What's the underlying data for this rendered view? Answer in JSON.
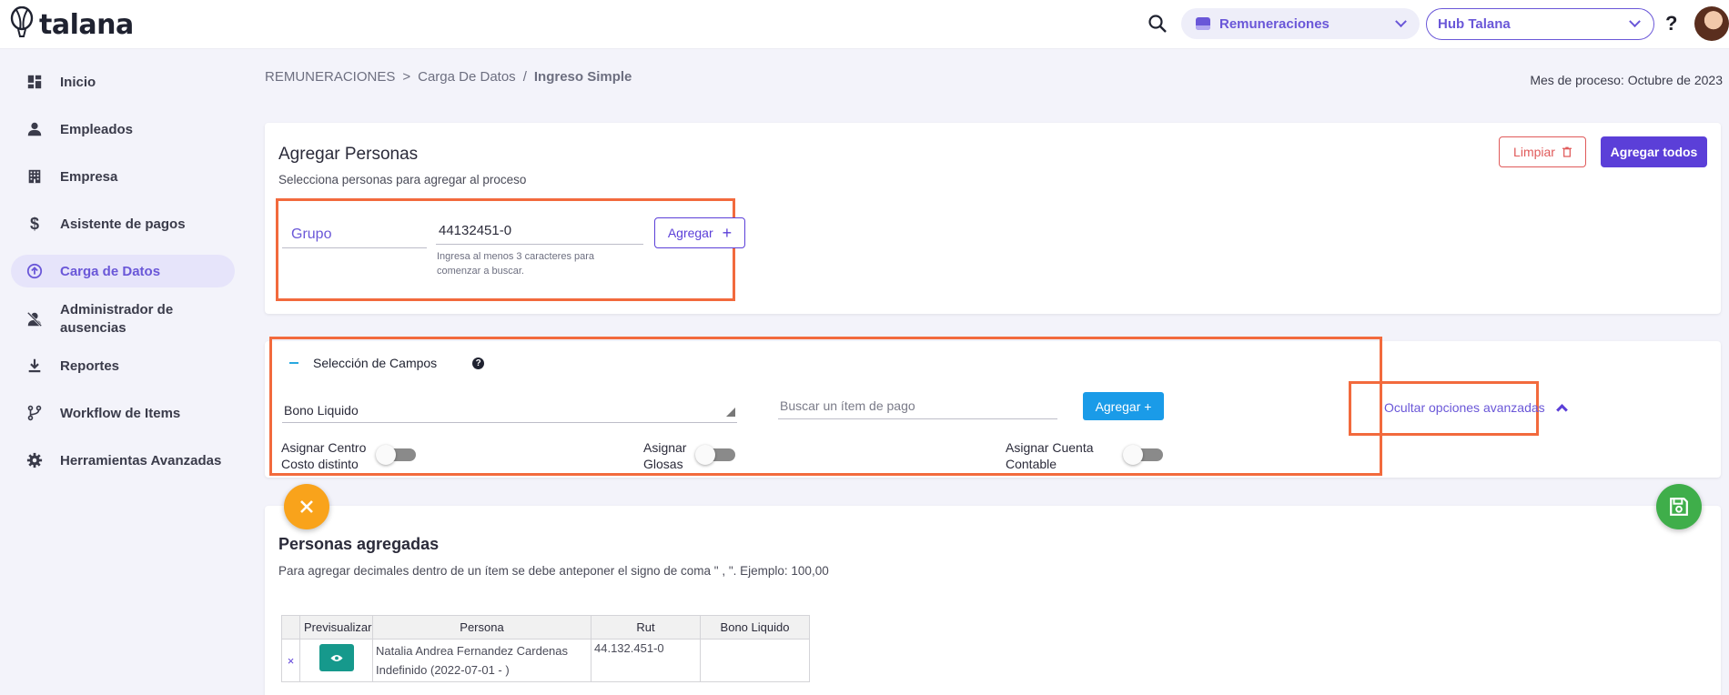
{
  "app": {
    "logo_text": "talana"
  },
  "header": {
    "module_label": "Remuneraciones",
    "hub_label": "Hub Talana",
    "help_label": "?"
  },
  "sidebar": {
    "items": [
      {
        "label": "Inicio",
        "icon": "dashboard-icon",
        "active": false
      },
      {
        "label": "Empleados",
        "icon": "person-icon",
        "active": false
      },
      {
        "label": "Empresa",
        "icon": "building-icon",
        "active": false
      },
      {
        "label": "Asistente de pagos",
        "icon": "dollar-icon",
        "active": false
      },
      {
        "label": "Carga de Datos",
        "icon": "upload-icon",
        "active": true
      },
      {
        "label": "Administrador de ausencias",
        "icon": "person-off-icon",
        "active": false
      },
      {
        "label": "Reportes",
        "icon": "download-icon",
        "active": false
      },
      {
        "label": "Workflow de Items",
        "icon": "workflow-icon",
        "active": false
      },
      {
        "label": "Herramientas Avanzadas",
        "icon": "gear-icon",
        "active": false
      }
    ]
  },
  "breadcrumb": {
    "root": "REMUNERACIONES",
    "sep1": ">",
    "middle": "Carga De Datos",
    "sep2": "/",
    "current": "Ingreso Simple"
  },
  "process_month": "Mes de proceso: Octubre de 2023",
  "agregar_personas": {
    "title": "Agregar Personas",
    "subtitle": "Selecciona personas para agregar al proceso",
    "limpiar_label": "Limpiar",
    "agregar_todos_label": "Agregar todos",
    "grupo_label": "Grupo",
    "rut_value": "44132451-0",
    "rut_hint": "Ingresa al menos 3 caracteres para comenzar a buscar.",
    "agregar_label": "Agregar"
  },
  "seleccion_campos": {
    "title": "Selección de Campos",
    "help_label": "?",
    "select_value": "Bono Liquido",
    "search_placeholder": "Buscar un ítem de pago",
    "agregar_plus_label": "Agregar +",
    "ocultar_label": "Ocultar opciones avanzadas",
    "switches": [
      {
        "label_line1": "Asignar Centro",
        "label_line2": "Costo distinto",
        "on": false
      },
      {
        "label_line1": "Asignar",
        "label_line2": "Glosas",
        "on": false
      },
      {
        "label_line1": "Asignar Cuenta",
        "label_line2": "Contable",
        "on": false
      }
    ]
  },
  "personas_agregadas": {
    "title": "Personas agregadas",
    "hint": "Para agregar decimales dentro de un ítem se debe anteponer el signo de coma \" , \". Ejemplo: 100,00",
    "columns": [
      "",
      "Previsualizar",
      "Persona",
      "Rut",
      "Bono Liquido"
    ],
    "rows": [
      {
        "delete": "×",
        "persona_name": "Natalia Andrea Fernandez Cardenas",
        "persona_contract": "Indefinido (2022-07-01 - )",
        "rut": "44.132.451-0",
        "bono_liquido": ""
      }
    ]
  },
  "colors": {
    "accent": "#6a57d8",
    "primary_button": "#5b3fd8",
    "danger": "#e05a5a",
    "highlight": "#f26a3d",
    "info_button": "#1a9be8",
    "fab_close": "#f9a31b",
    "fab_save": "#3fae4a",
    "preview_button": "#16998c"
  }
}
